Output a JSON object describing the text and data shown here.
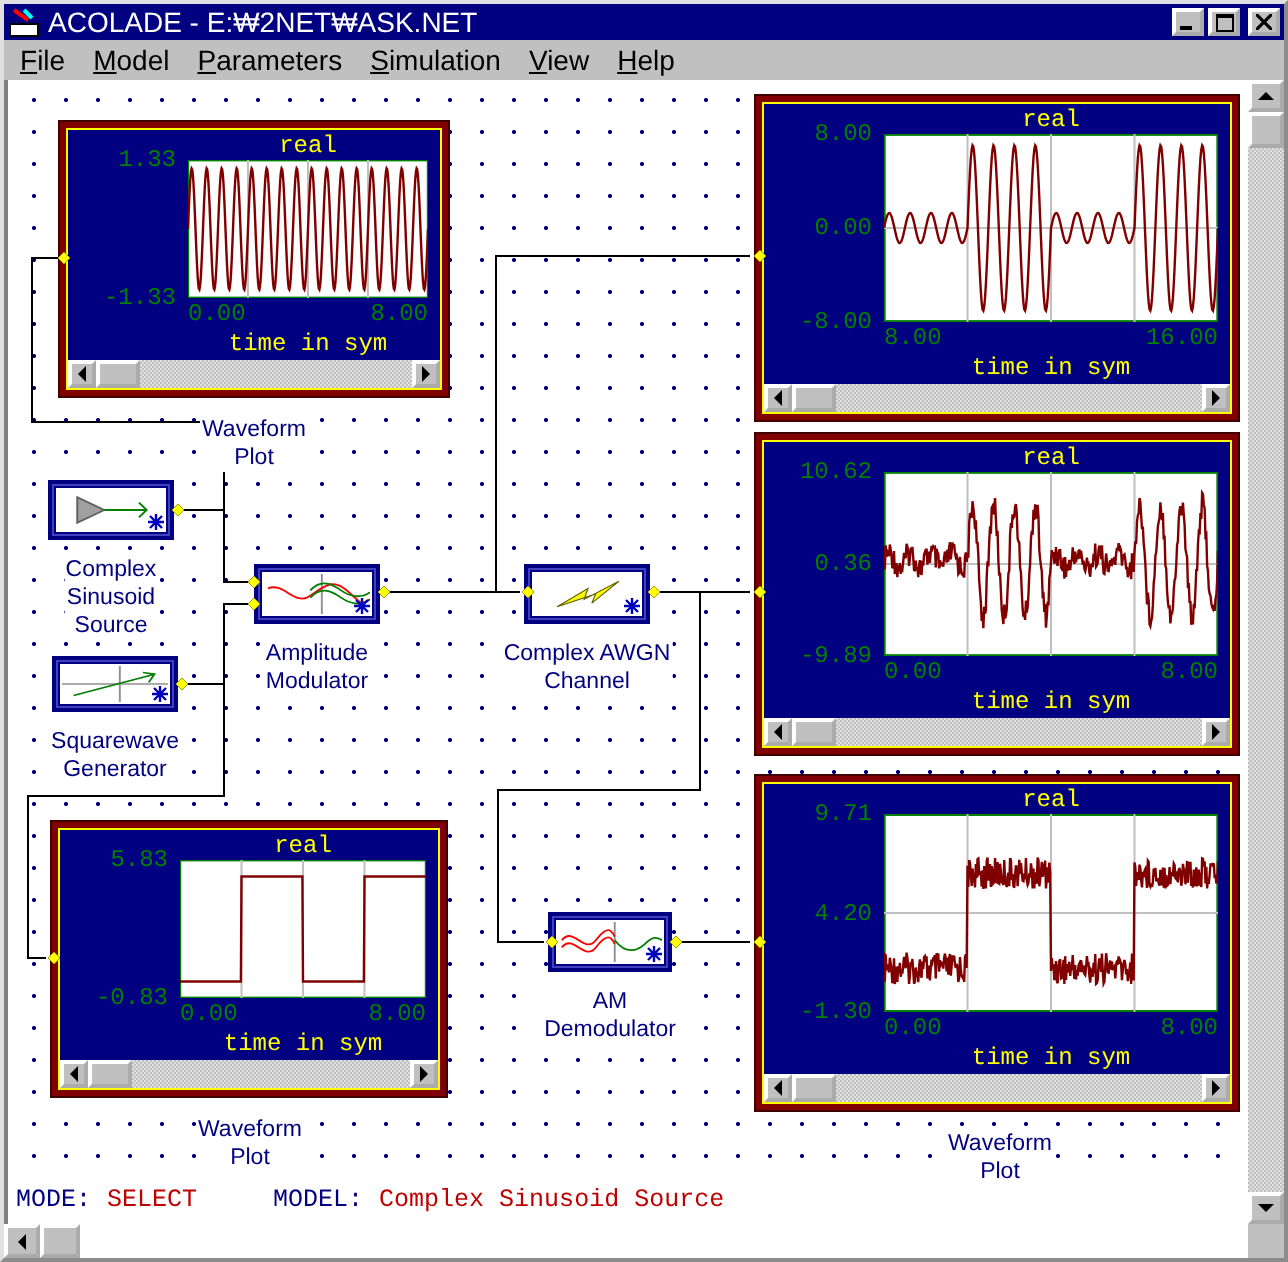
{
  "window": {
    "title": "ACOLADE - E:₩2NET₩ASK.NET"
  },
  "menu": [
    {
      "label": "File"
    },
    {
      "label": "Model"
    },
    {
      "label": "Parameters"
    },
    {
      "label": "Simulation"
    },
    {
      "label": "View"
    },
    {
      "label": "Help"
    }
  ],
  "plots": [
    {
      "kind": "sine",
      "title": "real",
      "y_ticks": [
        "1.33",
        "-1.33"
      ],
      "x_ticks": [
        "0.00",
        "8.00"
      ],
      "xlabel": "time in sym",
      "label": [
        "Waveform",
        "Plot"
      ]
    },
    {
      "kind": "am",
      "title": "real",
      "y_ticks": [
        "8.00",
        "0.00",
        "-8.00"
      ],
      "x_ticks": [
        "8.00",
        "16.00"
      ],
      "xlabel": "time in sym"
    },
    {
      "kind": "noisy_am",
      "title": "real",
      "y_ticks": [
        "10.62",
        "0.36",
        "-9.89"
      ],
      "x_ticks": [
        "0.00",
        "8.00"
      ],
      "xlabel": "time in sym"
    },
    {
      "kind": "demod",
      "title": "real",
      "y_ticks": [
        "9.71",
        "4.20",
        "-1.30"
      ],
      "x_ticks": [
        "0.00",
        "8.00"
      ],
      "xlabel": "time in sym",
      "label": [
        "Waveform",
        "Plot"
      ]
    },
    {
      "kind": "square",
      "title": "real",
      "y_ticks": [
        "5.83",
        "-0.83"
      ],
      "x_ticks": [
        "0.00",
        "8.00"
      ],
      "xlabel": "time in sym",
      "label": [
        "Waveform",
        "Plot"
      ]
    }
  ],
  "blocks": [
    {
      "kind": "source",
      "label": [
        "Complex",
        "Sinusoid",
        "Source"
      ]
    },
    {
      "kind": "square",
      "label": [
        "Squarewave",
        "Generator"
      ]
    },
    {
      "kind": "modulator",
      "label": [
        "Amplitude",
        "Modulator"
      ]
    },
    {
      "kind": "channel",
      "label": [
        "Complex AWGN",
        "Channel"
      ]
    },
    {
      "kind": "demodulator",
      "label": [
        "AM",
        "Demodulator"
      ]
    }
  ],
  "status": {
    "mode_label": "MODE:",
    "mode": "SELECT",
    "model_label": "MODEL:",
    "model": "Complex Sinusoid Source"
  }
}
